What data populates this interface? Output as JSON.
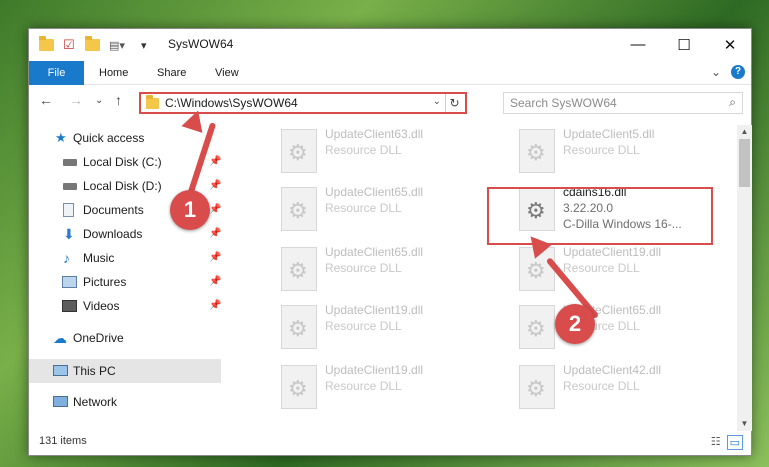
{
  "window": {
    "title": "SysWOW64",
    "controls": {
      "minimize": "—",
      "maximize": "☐",
      "close": "✕"
    }
  },
  "ribbon": {
    "tabs": [
      "File",
      "Home",
      "Share",
      "View"
    ],
    "collapse": "⌄",
    "help": "?"
  },
  "navigation": {
    "back": "←",
    "forward": "→",
    "recent": "⌄",
    "up": "↑",
    "address": "C:\\Windows\\SysWOW64",
    "address_dropdown": "⌄",
    "refresh": "↻",
    "search_placeholder": "Search SysWOW64",
    "search_icon": "search-icon"
  },
  "sidebar": {
    "items": [
      {
        "label": "Quick access",
        "icon": "star-icon",
        "pinned": false
      },
      {
        "label": "Local Disk (C:)",
        "icon": "drive-icon",
        "pinned": true
      },
      {
        "label": "Local Disk (D:)",
        "icon": "drive-icon",
        "pinned": true
      },
      {
        "label": "Documents",
        "icon": "document-icon",
        "pinned": true
      },
      {
        "label": "Downloads",
        "icon": "download-icon",
        "pinned": true
      },
      {
        "label": "Music",
        "icon": "music-icon",
        "pinned": true
      },
      {
        "label": "Pictures",
        "icon": "picture-icon",
        "pinned": true
      },
      {
        "label": "Videos",
        "icon": "video-icon",
        "pinned": true
      },
      {
        "label": "OneDrive",
        "icon": "cloud-icon",
        "pinned": false
      },
      {
        "label": "This PC",
        "icon": "computer-icon",
        "pinned": false,
        "selected": true
      },
      {
        "label": "Network",
        "icon": "network-icon",
        "pinned": false
      }
    ],
    "pin_glyph": "📌"
  },
  "files": [
    {
      "name": "UpdateClient63.dll",
      "type": "Resource DLL"
    },
    {
      "name": "UpdateClient5.dll",
      "type": "Resource DLL"
    },
    {
      "name": "UpdateClient65.dll",
      "type": "Resource DLL"
    },
    {
      "name": "cdains16.dll",
      "version": "3.22.20.0",
      "desc": "C-Dilla Windows 16-...",
      "focused": true
    },
    {
      "name": "UpdateClient65.dll",
      "type": "Resource DLL"
    },
    {
      "name": "UpdateClient19.dll",
      "type": "Resource DLL"
    },
    {
      "name": "UpdateClient19.dll",
      "type": "Resource DLL"
    },
    {
      "name": "UpdateClient65.dll",
      "type": "Resource DLL"
    },
    {
      "name": "UpdateClient19.dll",
      "type": "Resource DLL"
    },
    {
      "name": "UpdateClient42.dll",
      "type": "Resource DLL"
    }
  ],
  "status": {
    "items": "131 items"
  },
  "annotations": {
    "step1": "1",
    "step2": "2",
    "color": "#d84c4c"
  }
}
